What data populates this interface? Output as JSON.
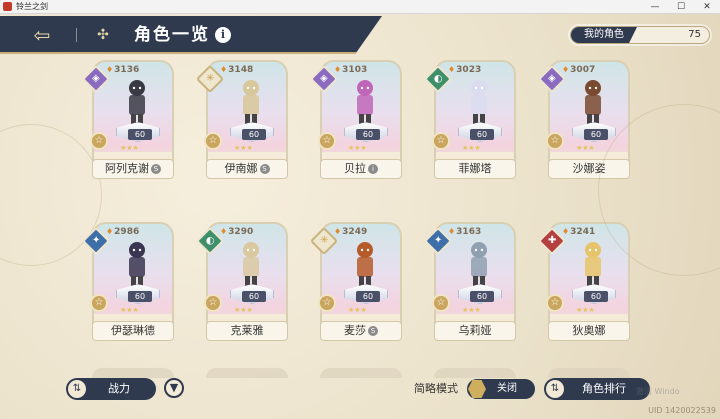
{
  "window": {
    "title": "铃兰之剑",
    "minimize": "—",
    "maximize": "☐",
    "close": "✕"
  },
  "header": {
    "back_icon": "⇦",
    "grid_icon": "✣",
    "title": "角色一览",
    "info_icon": "i"
  },
  "roster": {
    "label": "我的角色",
    "count": "75"
  },
  "characters": [
    {
      "name": "阿列克谢",
      "power": "3136",
      "level": "60",
      "element_color": "#8a6bbf",
      "element_icon": "◈",
      "badge": "☆",
      "skill": "S"
    },
    {
      "name": "伊南娜",
      "power": "3148",
      "level": "60",
      "element_color": "#efe6cf",
      "element_icon": "✳",
      "badge": "☆",
      "skill": "S"
    },
    {
      "name": "贝拉",
      "power": "3103",
      "level": "60",
      "element_color": "#8a6bbf",
      "element_icon": "◈",
      "badge": "☆",
      "skill": "i"
    },
    {
      "name": "菲娜塔",
      "power": "3023",
      "level": "60",
      "element_color": "#3f8f6a",
      "element_icon": "◐",
      "badge": "☆",
      "skill": ""
    },
    {
      "name": "沙娜姿",
      "power": "3007",
      "level": "60",
      "element_color": "#8a6bbf",
      "element_icon": "◈",
      "badge": "☆",
      "skill": ""
    },
    {
      "name": "伊瑟琳德",
      "power": "2986",
      "level": "60",
      "element_color": "#3f6fa8",
      "element_icon": "✦",
      "badge": "☆",
      "skill": ""
    },
    {
      "name": "克莱雅",
      "power": "3290",
      "level": "60",
      "element_color": "#3f8f6a",
      "element_icon": "◐",
      "badge": "☆",
      "skill": ""
    },
    {
      "name": "麦莎",
      "power": "3249",
      "level": "60",
      "element_color": "#efe6cf",
      "element_icon": "✳",
      "badge": "☆",
      "skill": "S"
    },
    {
      "name": "乌莉娅",
      "power": "3163",
      "level": "60",
      "element_color": "#3f6fa8",
      "element_icon": "✦",
      "badge": "☆",
      "skill": ""
    },
    {
      "name": "狄奥娜",
      "power": "3241",
      "level": "60",
      "element_color": "#b54040",
      "element_icon": "✚",
      "badge": "☆",
      "skill": ""
    }
  ],
  "stars_text": "★★★",
  "footer": {
    "power_label": "战力",
    "power_icon": "⇅",
    "filter_icon": "▼",
    "simple_mode_label": "简略模式",
    "toggle_label": "关闭",
    "ranking_label": "角色排行",
    "ranking_icon": "⇅",
    "watermark": "激活 Windo",
    "uid": "UID 1420022539"
  }
}
